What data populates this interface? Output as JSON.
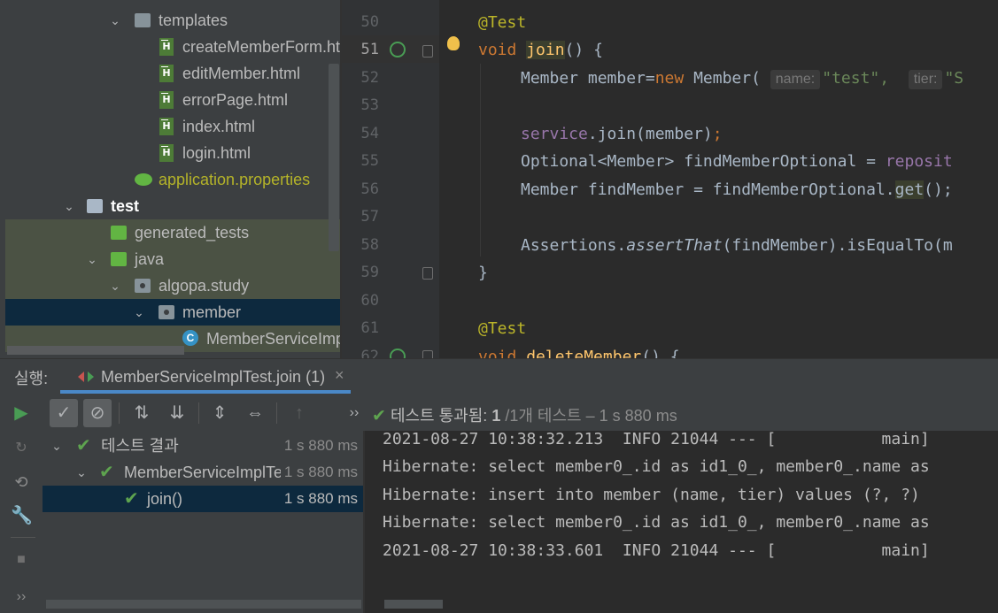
{
  "project_tree": {
    "items": [
      {
        "label": "templates",
        "type": "folder"
      },
      {
        "label": "createMemberForm.html",
        "type": "html"
      },
      {
        "label": "editMember.html",
        "type": "html"
      },
      {
        "label": "errorPage.html",
        "type": "html"
      },
      {
        "label": "index.html",
        "type": "html"
      },
      {
        "label": "login.html",
        "type": "html"
      },
      {
        "label": "application.properties",
        "type": "properties"
      },
      {
        "label": "test",
        "type": "folder"
      },
      {
        "label": "generated_tests",
        "type": "folder"
      },
      {
        "label": "java",
        "type": "folder"
      },
      {
        "label": "algopa.study",
        "type": "package"
      },
      {
        "label": "member",
        "type": "package"
      },
      {
        "label": "MemberServiceImpl",
        "type": "class"
      }
    ]
  },
  "editor": {
    "line_numbers": [
      "50",
      "51",
      "52",
      "53",
      "54",
      "55",
      "56",
      "57",
      "58",
      "59",
      "60",
      "61",
      "62"
    ],
    "current_line": "51",
    "lines": {
      "l50": "@Test",
      "l51_kw": "void",
      "l51_fn": "join",
      "l51_rest": "() {",
      "l52_a": "Member member=",
      "l52_kw": "new",
      "l52_b": " Member(",
      "l52_hint1": "name:",
      "l52_str1": "\"test\",",
      "l52_hint2": "tier:",
      "l52_str2": "\"S",
      "l54_field": "service",
      "l54_rest": ".join(member)",
      "l54_semi": ";",
      "l55_a": "Optional<Member> findMemberOptional = ",
      "l55_field": "reposit",
      "l56_a": "Member findMember = findMemberOptional.",
      "l56_get": "get",
      "l56_rest": "();",
      "l58_a": "Assertions.",
      "l58_ital": "assertThat",
      "l58_rest": "(findMember).isEqualTo(m",
      "l59": "}",
      "l61": "@Test",
      "l62_kw": "void",
      "l62_fn": "deleteMember",
      "l62_rest": "() {"
    }
  },
  "run_window": {
    "label": "실행:",
    "tab_label": "MemberServiceImplTest.join (1)",
    "tab_close": "×",
    "status": {
      "prefix": "테스트 통과됨:",
      "count": "1",
      "total": "/1개 테스트",
      "duration": "– 1 s 880 ms"
    },
    "more_glyph": "››",
    "test_tree": [
      {
        "label": "테스트 결과",
        "duration": "1 s 880 ms"
      },
      {
        "label": "MemberServiceImplTe",
        "duration": "1 s 880 ms"
      },
      {
        "label": "join()",
        "duration": "1 s 880 ms"
      }
    ],
    "console_lines": [
      "2021-08-27 10:38:32.213  INFO 21044 --- [           main]",
      "Hibernate: select member0_.id as id1_0_, member0_.name as",
      "Hibernate: insert into member (name, tier) values (?, ?)",
      "Hibernate: select member0_.id as id1_0_, member0_.name as",
      "2021-08-27 10:38:33.601  INFO 21044 --- [           main]"
    ]
  },
  "colors": {
    "pass_green": "#5ea44f",
    "selection": "#0d293e",
    "accent_tab": "#4a88c7"
  }
}
